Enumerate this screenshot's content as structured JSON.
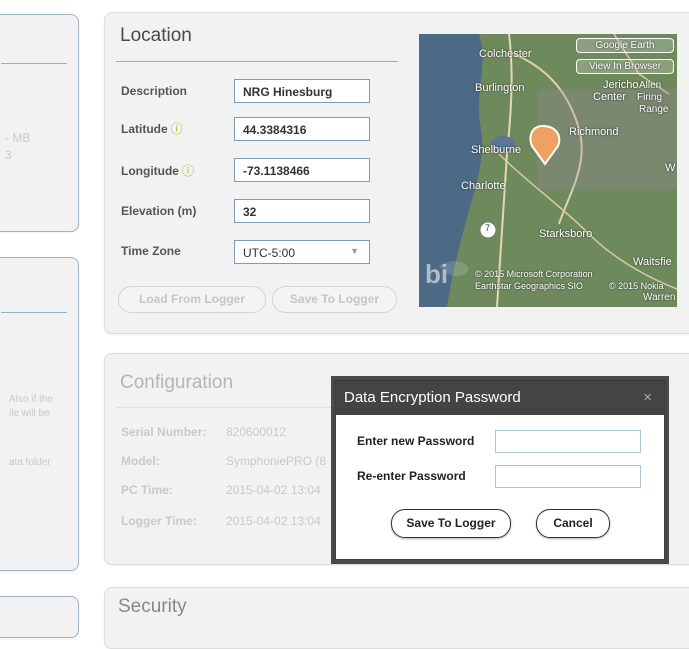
{
  "left_panels": {
    "top_partial_lines": [
      "- MB",
      "3"
    ],
    "middle_partial_lines": [
      "Also if the",
      "ile will be",
      "ata folder"
    ]
  },
  "location": {
    "title": "Location",
    "fields": {
      "description": {
        "label": "Description",
        "value": "NRG Hinesburg"
      },
      "latitude": {
        "label": "Latitude",
        "value": "44.3384316"
      },
      "longitude": {
        "label": "Longitude",
        "value": "-73.1138466"
      },
      "elevation": {
        "label": "Elevation (m)",
        "value": "32"
      },
      "timezone": {
        "label": "Time Zone",
        "value": "UTC-5:00"
      }
    },
    "info_icon": "info-circle-icon",
    "buttons": {
      "load": "Load From Logger",
      "save": "Save To Logger"
    },
    "map": {
      "buttons": {
        "earth": "Google Earth",
        "browser": "View In Browser"
      },
      "places": {
        "colchester": "Colchester",
        "burlington": "Burlington",
        "jericho": "Jericho",
        "center": "Center",
        "allen": "Allen",
        "firing": "Firing",
        "range": "Range",
        "richmond": "Richmond",
        "shelburne": "Shelburne",
        "charlotte": "Charlotte",
        "starksboro": "Starksboro",
        "waitsfield": "Waitsfie",
        "warren": "Warren",
        "w": "W",
        "route": "7"
      },
      "copyright1": "© 2015 Microsoft Corporation",
      "copyright2": "Earthstar Geographics SIO",
      "copyright3": "© 2015 Nokia",
      "logo": "bi"
    }
  },
  "configuration": {
    "title": "Configuration",
    "rows": [
      {
        "label": "Serial Number:",
        "value": "820600012"
      },
      {
        "label": "Model:",
        "value": "SymphoniePRO (8"
      },
      {
        "label": "PC Time:",
        "value": "2015-04-02 13:04"
      },
      {
        "label": "Logger Time:",
        "value": "2015-04-02 13:04"
      }
    ]
  },
  "security": {
    "title": "Security"
  },
  "dialog": {
    "title": "Data Encryption Password",
    "close": "×",
    "new_password_label": "Enter new Password",
    "reenter_label": "Re-enter Password",
    "save_button": "Save To Logger",
    "cancel_button": "Cancel"
  },
  "colors": {
    "accent_rule": "#8fb3c9",
    "dialog_titlebar": "#444444",
    "map_pin": "#f0a060"
  }
}
